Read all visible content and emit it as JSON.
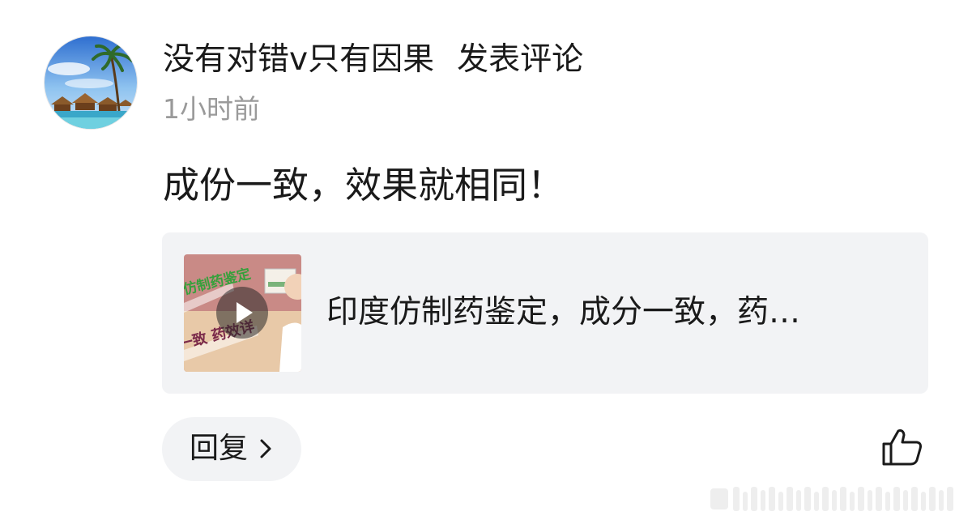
{
  "comment": {
    "author": "没有对错v只有因果",
    "action": "发表评论",
    "time": "1小时前",
    "text": "成份一致，效果就相同！"
  },
  "link_card": {
    "title": "印度仿制药鉴定，成分一致，药…",
    "thumbnail_caption_top": "仿制药鉴定",
    "thumbnail_caption_bottom": "一致 药效详"
  },
  "actions": {
    "reply_label": "回复",
    "reply_icon": "chevron-right-icon",
    "like_icon": "thumbs-up-icon"
  },
  "colors": {
    "card_background": "#f2f3f5",
    "secondary_text": "#9a9a9a",
    "primary_text": "#1a1a1a"
  }
}
